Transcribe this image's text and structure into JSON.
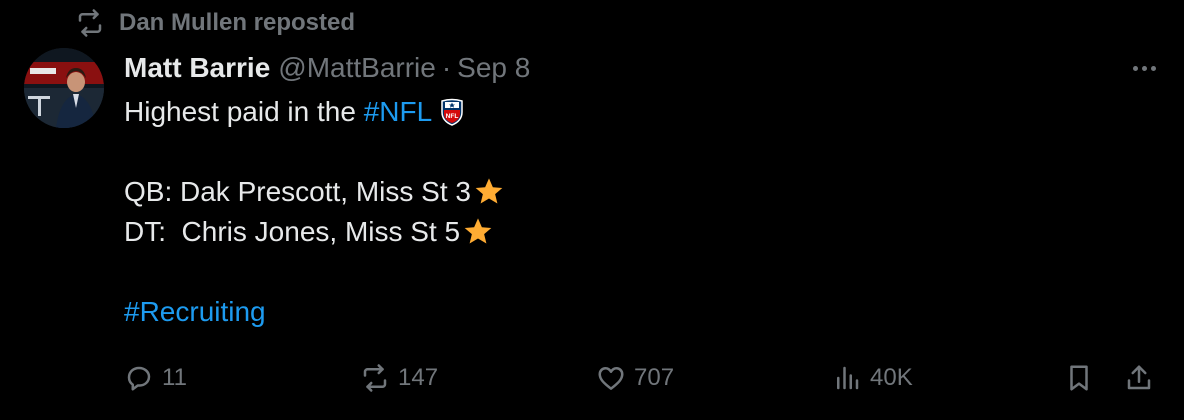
{
  "repost": {
    "text": "Dan Mullen reposted",
    "icon": "repost-icon"
  },
  "author": {
    "name": "Matt Barrie",
    "handle": "@MattBarrie",
    "separator": "·",
    "date": "Sep 8"
  },
  "tweet": {
    "line1_text": "Highest paid in the ",
    "line1_hashtag": "#NFL",
    "line1_emoji": "nfl-shield-emoji",
    "line3_text": "QB: Dak Prescott, Miss St 3",
    "line3_emoji": "star-emoji",
    "line4_text": "DT:  Chris Jones, Miss St 5",
    "line4_emoji": "star-emoji",
    "line6_hashtag": "#Recruiting"
  },
  "actions": {
    "replies": "11",
    "reposts": "147",
    "likes": "707",
    "views": "40K"
  },
  "colors": {
    "background": "#000000",
    "text": "#e7e9ea",
    "muted": "#71767b",
    "link": "#1d9bf0",
    "star": "#ffac33"
  }
}
